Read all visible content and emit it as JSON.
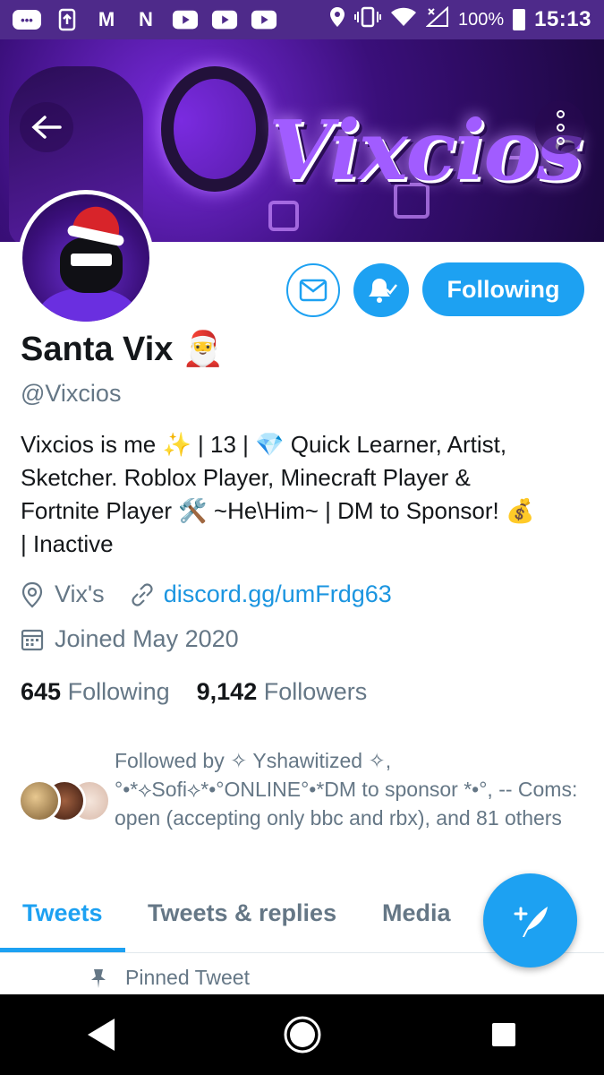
{
  "status_bar": {
    "battery": "100%",
    "time": "15:13",
    "left_icons": [
      "messages-icon",
      "upload-icon",
      "gmail-icon",
      "netflix-icon",
      "youtube-icon",
      "youtube-icon",
      "youtube-icon"
    ],
    "right_icons": [
      "location-icon",
      "vibrate-icon",
      "wifi-icon",
      "signal-icon",
      "battery-icon"
    ]
  },
  "banner": {
    "logo_text": "Vixcios"
  },
  "actions": {
    "follow_label": "Following"
  },
  "profile": {
    "name": "Santa Vix",
    "name_emoji": "🎅",
    "handle": "@Vixcios",
    "bio_lines": [
      "Vixcios is me ✨ | 13 | 💎 Quick Learner, Artist,",
      "Sketcher. Roblox Player, Minecraft Player &",
      "Fortnite Player 🛠️ ~He\\Him~ | DM to Sponsor! 💰",
      "| Inactive"
    ],
    "location": "Vix's",
    "website": "discord.gg/umFrdg63",
    "joined": "Joined May 2020"
  },
  "counts": {
    "following_value": "645",
    "following_label": "Following",
    "followers_value": "9,142",
    "followers_label": "Followers"
  },
  "followed_by": {
    "text": "Followed by ✧ Yshawitized ✧, °•*⟡Sofi⟡*•°ONLINE°•*DM to sponsor *•°, -- Coms: open (accepting only bbc and rbx), and 81 others"
  },
  "tabs": [
    "Tweets",
    "Tweets & replies",
    "Media"
  ],
  "pinned": {
    "label": "Pinned Tweet"
  },
  "colors": {
    "accent": "#1da1f2",
    "status_bar": "#4e2a8a",
    "text_secondary": "#657786"
  }
}
